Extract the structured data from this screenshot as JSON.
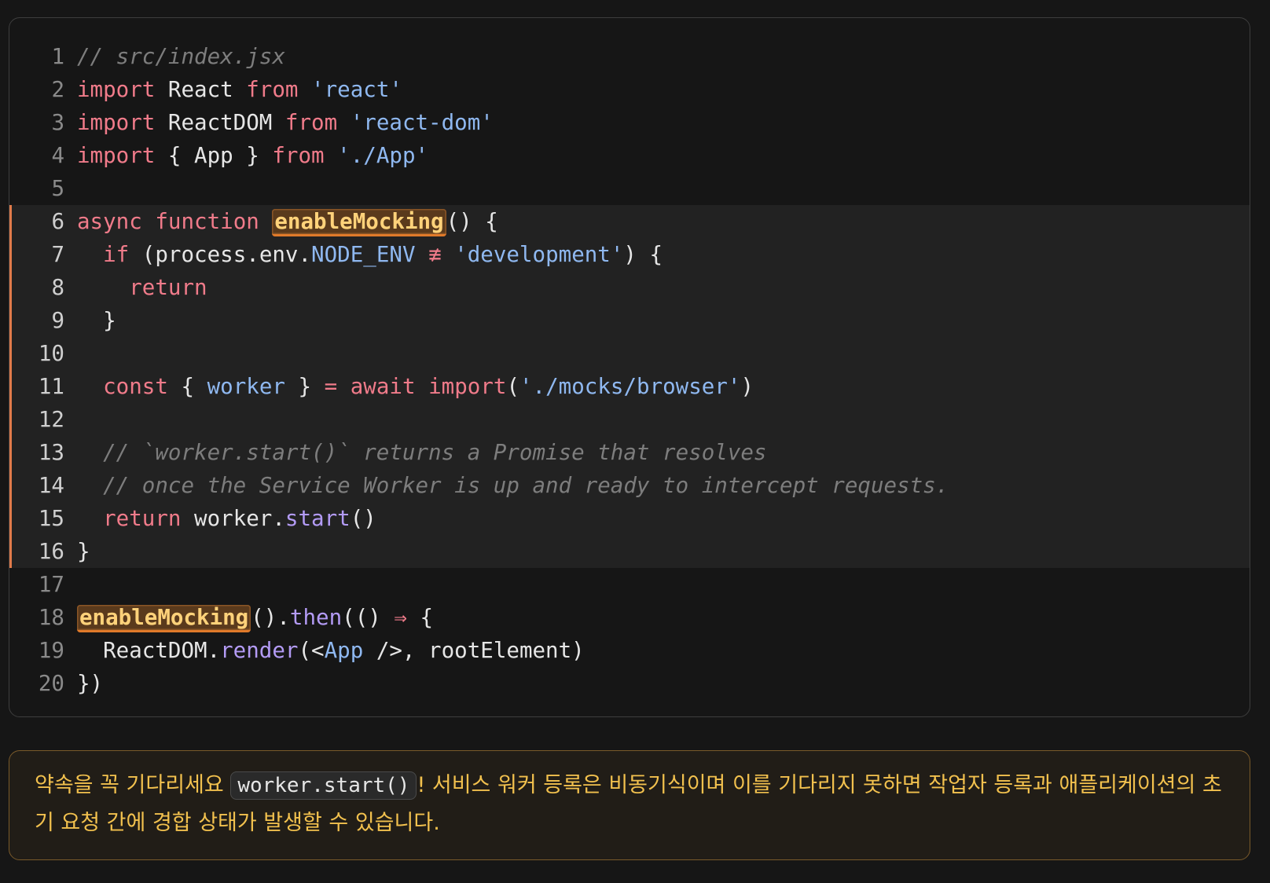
{
  "code_block": {
    "lines": [
      {
        "n": "1",
        "tokens": [
          {
            "t": "// src/index.jsx",
            "c": "cm"
          }
        ]
      },
      {
        "n": "2",
        "tokens": [
          {
            "t": "import",
            "c": "kw"
          },
          {
            "t": " React ",
            "c": "plain"
          },
          {
            "t": "from",
            "c": "kw"
          },
          {
            "t": " ",
            "c": "plain"
          },
          {
            "t": "'react'",
            "c": "str"
          }
        ]
      },
      {
        "n": "3",
        "tokens": [
          {
            "t": "import",
            "c": "kw"
          },
          {
            "t": " ReactDOM ",
            "c": "plain"
          },
          {
            "t": "from",
            "c": "kw"
          },
          {
            "t": " ",
            "c": "plain"
          },
          {
            "t": "'react-dom'",
            "c": "str"
          }
        ]
      },
      {
        "n": "4",
        "tokens": [
          {
            "t": "import",
            "c": "kw"
          },
          {
            "t": " { App } ",
            "c": "plain"
          },
          {
            "t": "from",
            "c": "kw"
          },
          {
            "t": " ",
            "c": "plain"
          },
          {
            "t": "'./App'",
            "c": "str"
          }
        ]
      },
      {
        "n": "5",
        "tokens": []
      },
      {
        "n": "6",
        "hl": true,
        "tokens": [
          {
            "t": "async",
            "c": "kw"
          },
          {
            "t": " ",
            "c": "plain"
          },
          {
            "t": "function",
            "c": "kw"
          },
          {
            "t": " ",
            "c": "plain"
          },
          {
            "t": "enableMocking",
            "c": "mark"
          },
          {
            "t": "() {",
            "c": "plain"
          }
        ]
      },
      {
        "n": "7",
        "hl": true,
        "tokens": [
          {
            "t": "  ",
            "c": "plain"
          },
          {
            "t": "if",
            "c": "kw"
          },
          {
            "t": " (process.env.",
            "c": "plain"
          },
          {
            "t": "NODE_ENV",
            "c": "var"
          },
          {
            "t": " ",
            "c": "plain"
          },
          {
            "t": "≢",
            "c": "op"
          },
          {
            "t": " ",
            "c": "plain"
          },
          {
            "t": "'development'",
            "c": "str"
          },
          {
            "t": ") {",
            "c": "plain"
          }
        ]
      },
      {
        "n": "8",
        "hl": true,
        "tokens": [
          {
            "t": "    ",
            "c": "plain"
          },
          {
            "t": "return",
            "c": "kw"
          }
        ]
      },
      {
        "n": "9",
        "hl": true,
        "tokens": [
          {
            "t": "  }",
            "c": "plain"
          }
        ]
      },
      {
        "n": "10",
        "hl": true,
        "tokens": []
      },
      {
        "n": "11",
        "hl": true,
        "tokens": [
          {
            "t": "  ",
            "c": "plain"
          },
          {
            "t": "const",
            "c": "kw"
          },
          {
            "t": " { ",
            "c": "plain"
          },
          {
            "t": "worker",
            "c": "var"
          },
          {
            "t": " } ",
            "c": "plain"
          },
          {
            "t": "=",
            "c": "op"
          },
          {
            "t": " ",
            "c": "plain"
          },
          {
            "t": "await",
            "c": "kw"
          },
          {
            "t": " ",
            "c": "plain"
          },
          {
            "t": "import",
            "c": "kw"
          },
          {
            "t": "(",
            "c": "plain"
          },
          {
            "t": "'./mocks/browser'",
            "c": "str"
          },
          {
            "t": ")",
            "c": "plain"
          }
        ]
      },
      {
        "n": "12",
        "hl": true,
        "tokens": []
      },
      {
        "n": "13",
        "hl": true,
        "tokens": [
          {
            "t": "  // `worker.start()` returns a Promise that resolves",
            "c": "cm"
          }
        ]
      },
      {
        "n": "14",
        "hl": true,
        "tokens": [
          {
            "t": "  // once the Service Worker is up and ready to intercept requests.",
            "c": "cm"
          }
        ]
      },
      {
        "n": "15",
        "hl": true,
        "tokens": [
          {
            "t": "  ",
            "c": "plain"
          },
          {
            "t": "return",
            "c": "kw"
          },
          {
            "t": " worker.",
            "c": "plain"
          },
          {
            "t": "start",
            "c": "fn"
          },
          {
            "t": "()",
            "c": "plain"
          }
        ]
      },
      {
        "n": "16",
        "hl": true,
        "tokens": [
          {
            "t": "}",
            "c": "plain"
          }
        ]
      },
      {
        "n": "17",
        "tokens": []
      },
      {
        "n": "18",
        "tokens": [
          {
            "t": "enableMocking",
            "c": "mark"
          },
          {
            "t": "().",
            "c": "plain"
          },
          {
            "t": "then",
            "c": "fn"
          },
          {
            "t": "(() ",
            "c": "plain"
          },
          {
            "t": "⇒",
            "c": "op"
          },
          {
            "t": " {",
            "c": "plain"
          }
        ]
      },
      {
        "n": "19",
        "tokens": [
          {
            "t": "  ReactDOM.",
            "c": "plain"
          },
          {
            "t": "render",
            "c": "fn"
          },
          {
            "t": "(<",
            "c": "plain"
          },
          {
            "t": "App",
            "c": "var"
          },
          {
            "t": " />, rootElement)",
            "c": "plain"
          }
        ]
      },
      {
        "n": "20",
        "tokens": [
          {
            "t": "})",
            "c": "plain"
          }
        ]
      }
    ]
  },
  "note": {
    "before": "약속을 꼭 기다리세요 ",
    "code": "worker.start()",
    "after": "! 서비스 워커 등록은 비동기식이며 이를 기다리지 못하면 작업자 등록과 애플리케이션의 초기 요청 간에 경합 상태가 발생할 수 있습니다."
  },
  "colors": {
    "background": "#161616",
    "keyword": "#f07b8a",
    "string": "#8fb8f0",
    "comment": "#7d7d7d",
    "function": "#b39bf5",
    "highlight_border": "#e07a4a",
    "note_text": "#f2c14e"
  }
}
